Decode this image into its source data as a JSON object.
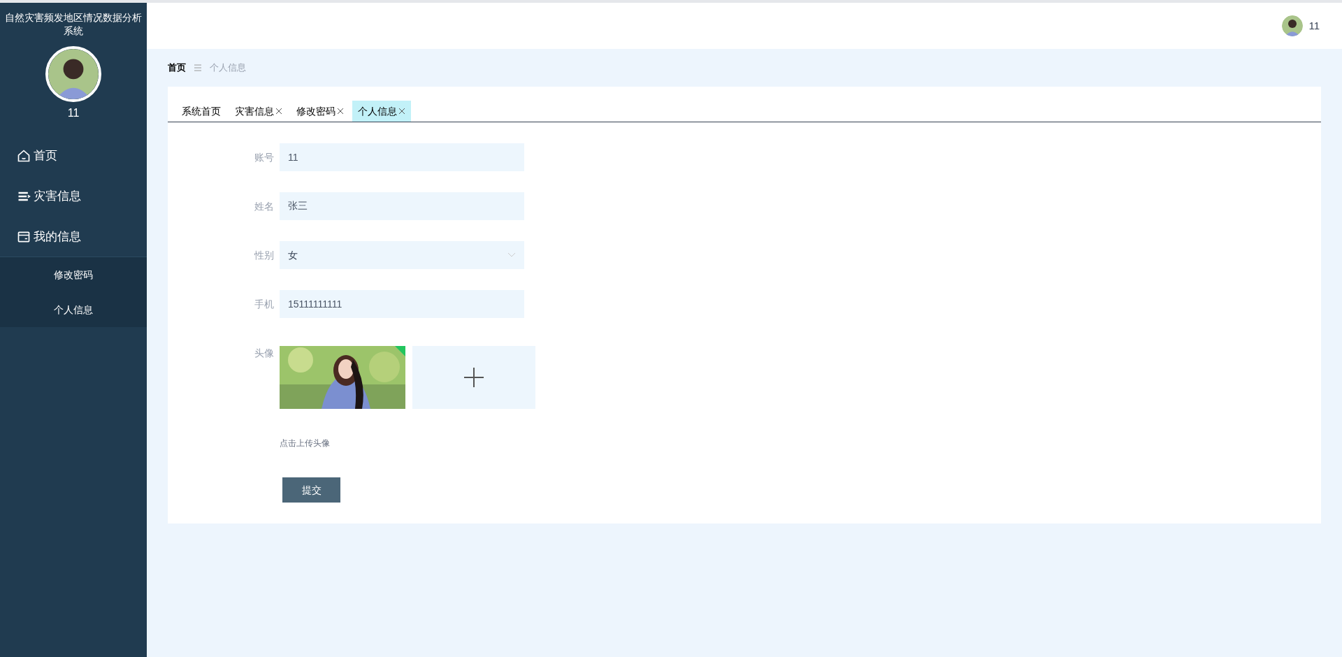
{
  "sidebar": {
    "title": "自然灾害频发地区情况数据分析系统",
    "username": "11",
    "menu": [
      {
        "label": "首页",
        "kind": "home",
        "expanded": false
      },
      {
        "label": "灾害信息",
        "kind": "list",
        "expanded": false
      },
      {
        "label": "我的信息",
        "kind": "card",
        "expanded": true,
        "children": [
          {
            "label": "修改密码"
          },
          {
            "label": "个人信息"
          }
        ]
      }
    ]
  },
  "header": {
    "username": "11"
  },
  "breadcrumb": {
    "items": [
      "首页",
      "个人信息"
    ]
  },
  "tabs": [
    {
      "label": "系统首页",
      "closable": false,
      "selected": false
    },
    {
      "label": "灾害信息",
      "closable": true,
      "selected": false
    },
    {
      "label": "修改密码",
      "closable": true,
      "selected": false
    },
    {
      "label": "个人信息",
      "closable": true,
      "selected": true
    }
  ],
  "form": {
    "fields": [
      {
        "kind": "text",
        "label": "账号",
        "value": "11"
      },
      {
        "kind": "text",
        "label": "姓名",
        "value": "张三"
      },
      {
        "kind": "select",
        "label": "性别",
        "value": "女"
      },
      {
        "kind": "text",
        "label": "手机",
        "value": "15111111111"
      },
      {
        "kind": "upload",
        "label": "头像",
        "hint": "点击上传头像"
      }
    ],
    "submit": "提交"
  }
}
